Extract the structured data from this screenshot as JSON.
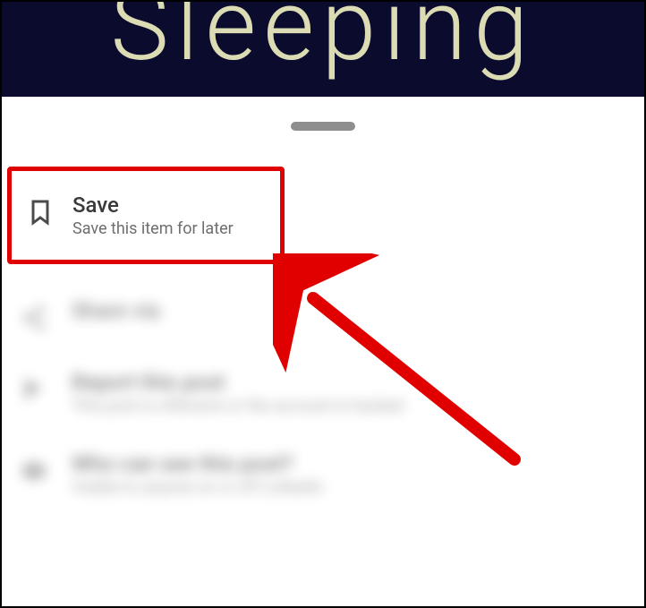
{
  "header": {
    "title": "Sleeping"
  },
  "menu": {
    "save": {
      "title": "Save",
      "subtitle": "Save this item for later"
    },
    "share": {
      "title": "Share via"
    },
    "report": {
      "title": "Report this post",
      "subtitle": "This post is offensive or the account is hacked"
    },
    "visibility": {
      "title": "Who can see this post?",
      "subtitle": "Visible to anyone on or off LinkedIn"
    }
  }
}
